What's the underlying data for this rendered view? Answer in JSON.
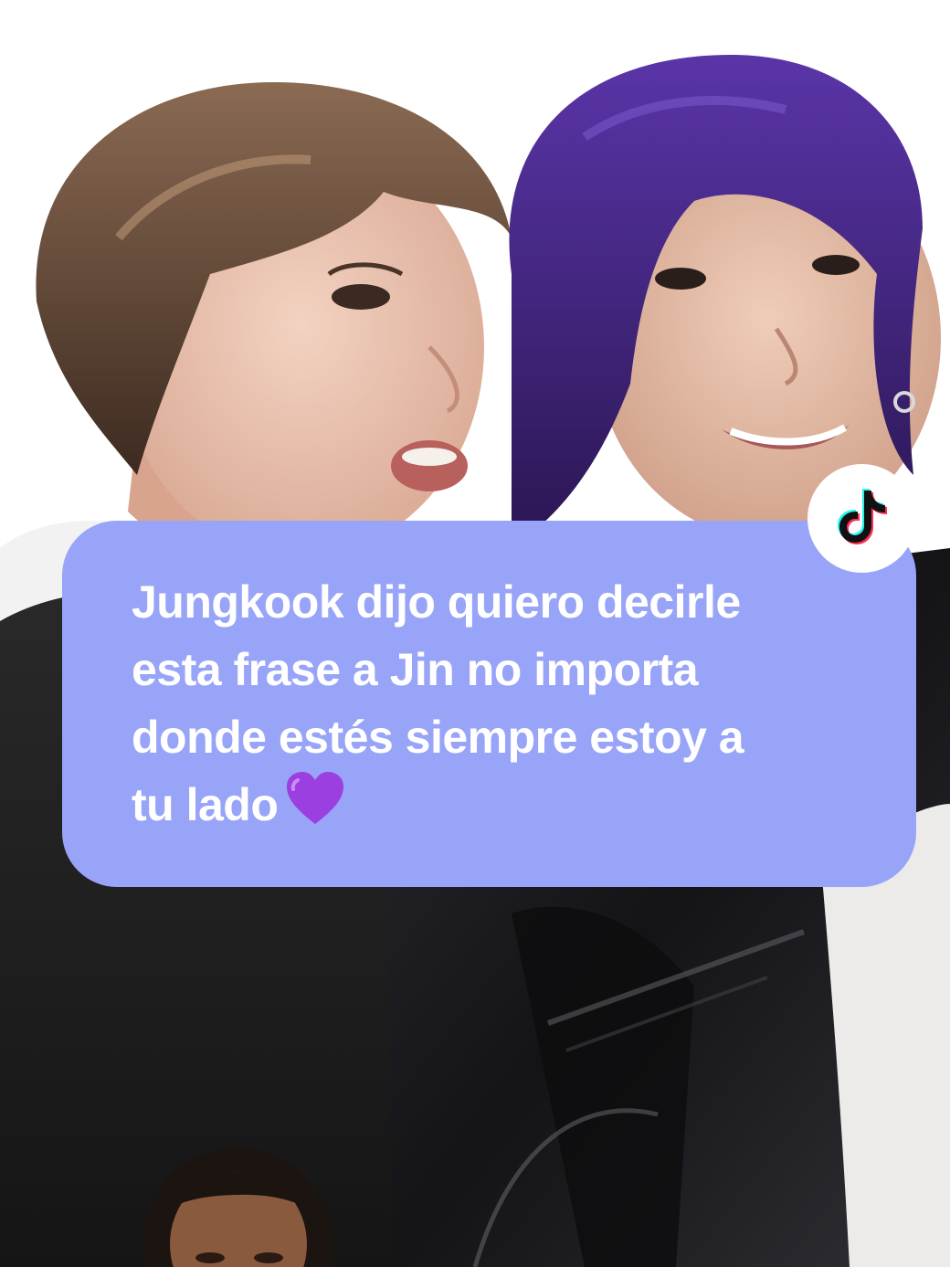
{
  "caption": {
    "text": "Jungkook dijo quiero decirle\nesta frase a Jin no importa\ndonde estés siempre estoy a\ntu lado",
    "emoji": "💜"
  },
  "badge": {
    "icon": "tiktok-logo-icon"
  },
  "colors": {
    "bubble": "#98a4f7",
    "text": "#ffffff",
    "hair_purple": "#4a2a8a",
    "jacket": "#1e1e22"
  }
}
